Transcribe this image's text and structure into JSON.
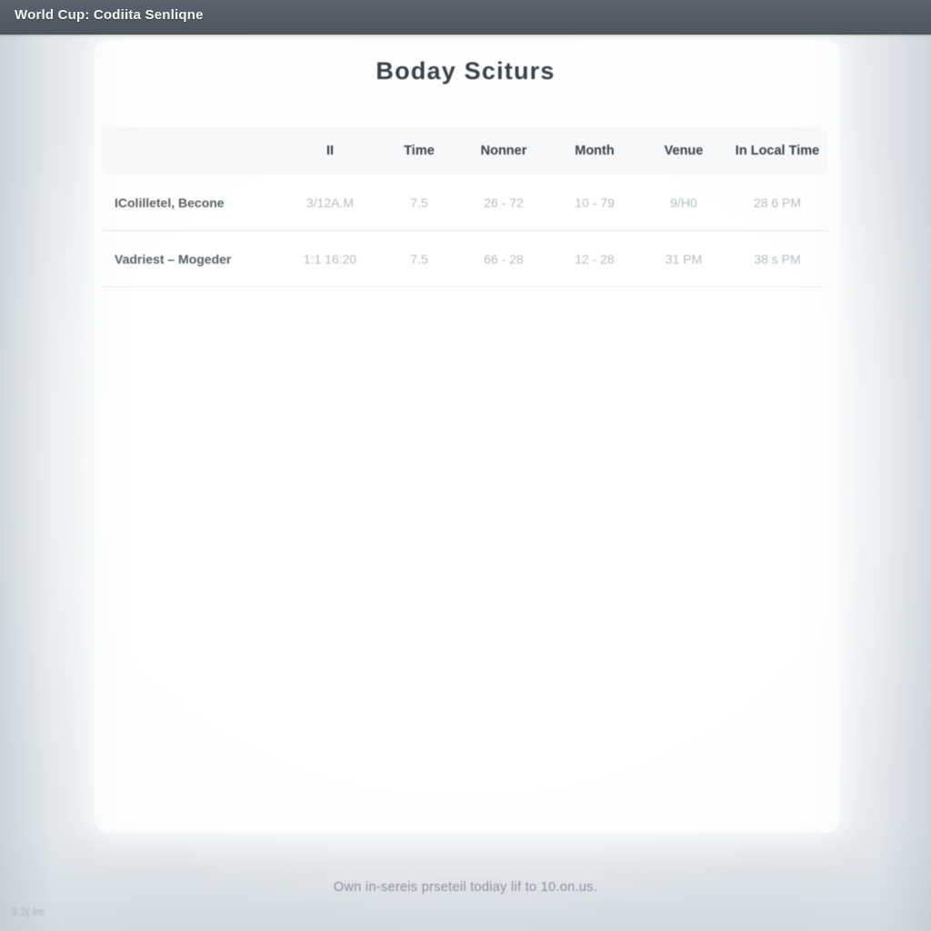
{
  "window": {
    "title": "World Cup: Codiita Senliqne"
  },
  "content": {
    "title": "Boday Sciturs",
    "footer_note": "Own in-sereis prseteil todiay lif to 10.on.us.",
    "corner_status": "3:2( lm"
  },
  "table": {
    "headers": [
      "",
      "II",
      "Time",
      "Nonner",
      "Month",
      "Venue",
      "In Local Time"
    ],
    "rows": [
      {
        "label": "IColilletel, Becone",
        "cells": [
          "3/12A.M",
          "7.5",
          "26 - 72",
          "10 - 79",
          "9/H0",
          "28 6 PM"
        ]
      },
      {
        "label": "Vadriest – Mogeder",
        "cells": [
          "1:1 16:20",
          "7.5",
          "66 - 28",
          "12 - 28",
          "31 PM",
          "38 s PM"
        ]
      }
    ]
  },
  "colors": {
    "titlebar": "#545d67",
    "title_text": "#3c4146",
    "header_text": "#3b4045",
    "cell_text": "#b9bdc1",
    "row_label_text": "#5a5f64",
    "footer_text": "#8d9399"
  }
}
